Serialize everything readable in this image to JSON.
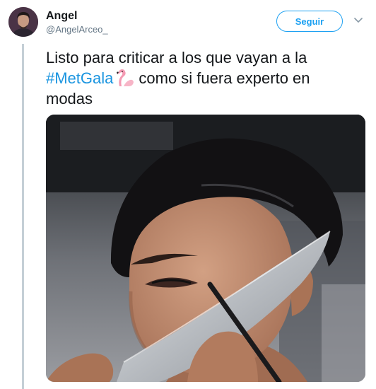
{
  "tweet": {
    "author": {
      "display_name": "Angel",
      "handle": "@AngelArceo_"
    },
    "follow_label": "Seguir",
    "text": {
      "line1": "Listo para criticar a los que vayan a la",
      "hashtag": "#MetGala",
      "emoji": "flamingo",
      "after_emoji": "como si fuera experto en",
      "line3": "modas"
    },
    "media": {
      "kind": "photo",
      "subject": "knife-held-to-face-as-eyeliner-guide"
    }
  },
  "colors": {
    "accent": "#1da1f2",
    "hashtag": "#1b95e0",
    "text": "#14171a",
    "secondary": "#657786",
    "thread_line": "#c4cfd6"
  }
}
